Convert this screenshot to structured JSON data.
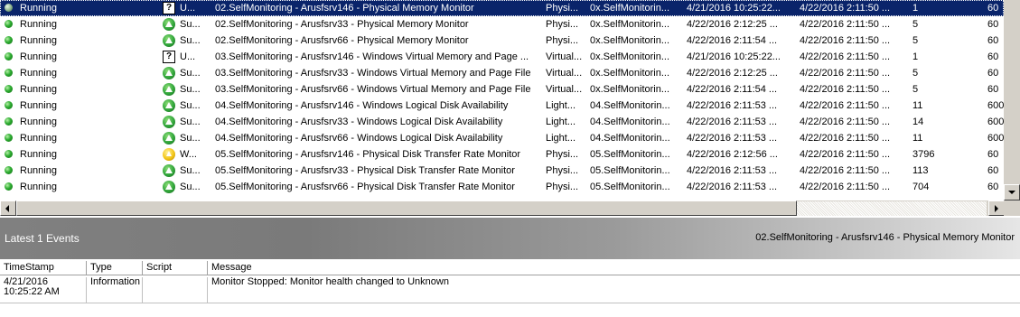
{
  "state_rows": [
    {
      "state": "Running",
      "status_icon": "unknown-icon",
      "status": "U...",
      "name": "02.SelfMonitoring - Arusfsrv146 - Physical Memory Monitor",
      "type": "Physi...",
      "group": "0x.SelfMonitorin...",
      "time1": "4/21/2016 10:25:22...",
      "time2": "4/22/2016 2:11:50 ...",
      "count": "1",
      "interval": "60",
      "selected": true
    },
    {
      "state": "Running",
      "status_icon": "success-icon",
      "status": "Su...",
      "name": "02.SelfMonitoring - Arusfsrv33 - Physical Memory Monitor",
      "type": "Physi...",
      "group": "0x.SelfMonitorin...",
      "time1": "4/22/2016 2:12:25 ...",
      "time2": "4/22/2016 2:11:50 ...",
      "count": "5",
      "interval": "60"
    },
    {
      "state": "Running",
      "status_icon": "success-icon",
      "status": "Su...",
      "name": "02.SelfMonitoring - Arusfsrv66 - Physical Memory Monitor",
      "type": "Physi...",
      "group": "0x.SelfMonitorin...",
      "time1": "4/22/2016 2:11:54 ...",
      "time2": "4/22/2016 2:11:50 ...",
      "count": "5",
      "interval": "60"
    },
    {
      "state": "Running",
      "status_icon": "unknown-icon",
      "status": "U...",
      "name": "03.SelfMonitoring - Arusfsrv146 - Windows Virtual Memory and Page ...",
      "type": "Virtual...",
      "group": "0x.SelfMonitorin...",
      "time1": "4/21/2016 10:25:22...",
      "time2": "4/22/2016 2:11:50 ...",
      "count": "1",
      "interval": "60"
    },
    {
      "state": "Running",
      "status_icon": "success-icon",
      "status": "Su...",
      "name": "03.SelfMonitoring - Arusfsrv33 - Windows Virtual Memory and Page File",
      "type": "Virtual...",
      "group": "0x.SelfMonitorin...",
      "time1": "4/22/2016 2:12:25 ...",
      "time2": "4/22/2016 2:11:50 ...",
      "count": "5",
      "interval": "60"
    },
    {
      "state": "Running",
      "status_icon": "success-icon",
      "status": "Su...",
      "name": "03.SelfMonitoring - Arusfsrv66 - Windows Virtual Memory and Page File",
      "type": "Virtual...",
      "group": "0x.SelfMonitorin...",
      "time1": "4/22/2016 2:11:54 ...",
      "time2": "4/22/2016 2:11:50 ...",
      "count": "5",
      "interval": "60"
    },
    {
      "state": "Running",
      "status_icon": "success-icon",
      "status": "Su...",
      "name": "04.SelfMonitoring - Arusfsrv146 - Windows Logical Disk Availability",
      "type": "Light...",
      "group": "04.SelfMonitorin...",
      "time1": "4/22/2016 2:11:53 ...",
      "time2": "4/22/2016 2:11:50 ...",
      "count": "11",
      "interval": "600"
    },
    {
      "state": "Running",
      "status_icon": "success-icon",
      "status": "Su...",
      "name": "04.SelfMonitoring - Arusfsrv33 - Windows Logical Disk Availability",
      "type": "Light...",
      "group": "04.SelfMonitorin...",
      "time1": "4/22/2016 2:11:53 ...",
      "time2": "4/22/2016 2:11:50 ...",
      "count": "14",
      "interval": "600"
    },
    {
      "state": "Running",
      "status_icon": "success-icon",
      "status": "Su...",
      "name": "04.SelfMonitoring - Arusfsrv66 - Windows Logical Disk Availability",
      "type": "Light...",
      "group": "04.SelfMonitorin...",
      "time1": "4/22/2016 2:11:53 ...",
      "time2": "4/22/2016 2:11:50 ...",
      "count": "11",
      "interval": "600"
    },
    {
      "state": "Running",
      "status_icon": "warning-icon",
      "status": "W...",
      "name": "05.SelfMonitoring - Arusfsrv146 - Physical Disk Transfer Rate Monitor",
      "type": "Physi...",
      "group": "05.SelfMonitorin...",
      "time1": "4/22/2016 2:12:56 ...",
      "time2": "4/22/2016 2:11:50 ...",
      "count": "3796",
      "interval": "60"
    },
    {
      "state": "Running",
      "status_icon": "success-icon",
      "status": "Su...",
      "name": "05.SelfMonitoring - Arusfsrv33 - Physical Disk Transfer Rate Monitor",
      "type": "Physi...",
      "group": "05.SelfMonitorin...",
      "time1": "4/22/2016 2:11:53 ...",
      "time2": "4/22/2016 2:11:50 ...",
      "count": "113",
      "interval": "60"
    },
    {
      "state": "Running",
      "status_icon": "success-icon",
      "status": "Su...",
      "name": "05.SelfMonitoring - Arusfsrv66 - Physical Disk Transfer Rate Monitor",
      "type": "Physi...",
      "group": "05.SelfMonitorin...",
      "time1": "4/22/2016 2:11:53 ...",
      "time2": "4/22/2016 2:11:50 ...",
      "count": "704",
      "interval": "60"
    }
  ],
  "events_panel": {
    "title": "Latest 1 Events",
    "context": "02.SelfMonitoring - Arusfsrv146 - Physical Memory Monitor",
    "columns": [
      "TimeStamp",
      "Type",
      "Script",
      "Message"
    ],
    "rows": [
      {
        "timestamp_line1": "4/21/2016",
        "timestamp_line2": "10:25:22 AM",
        "type": "Information",
        "script": "",
        "message": "Monitor Stopped: Monitor health changed to Unknown"
      }
    ]
  },
  "colors": {
    "selection": "#0a246a",
    "running_dot": "#2bab2f",
    "warning": "#f3c515"
  }
}
